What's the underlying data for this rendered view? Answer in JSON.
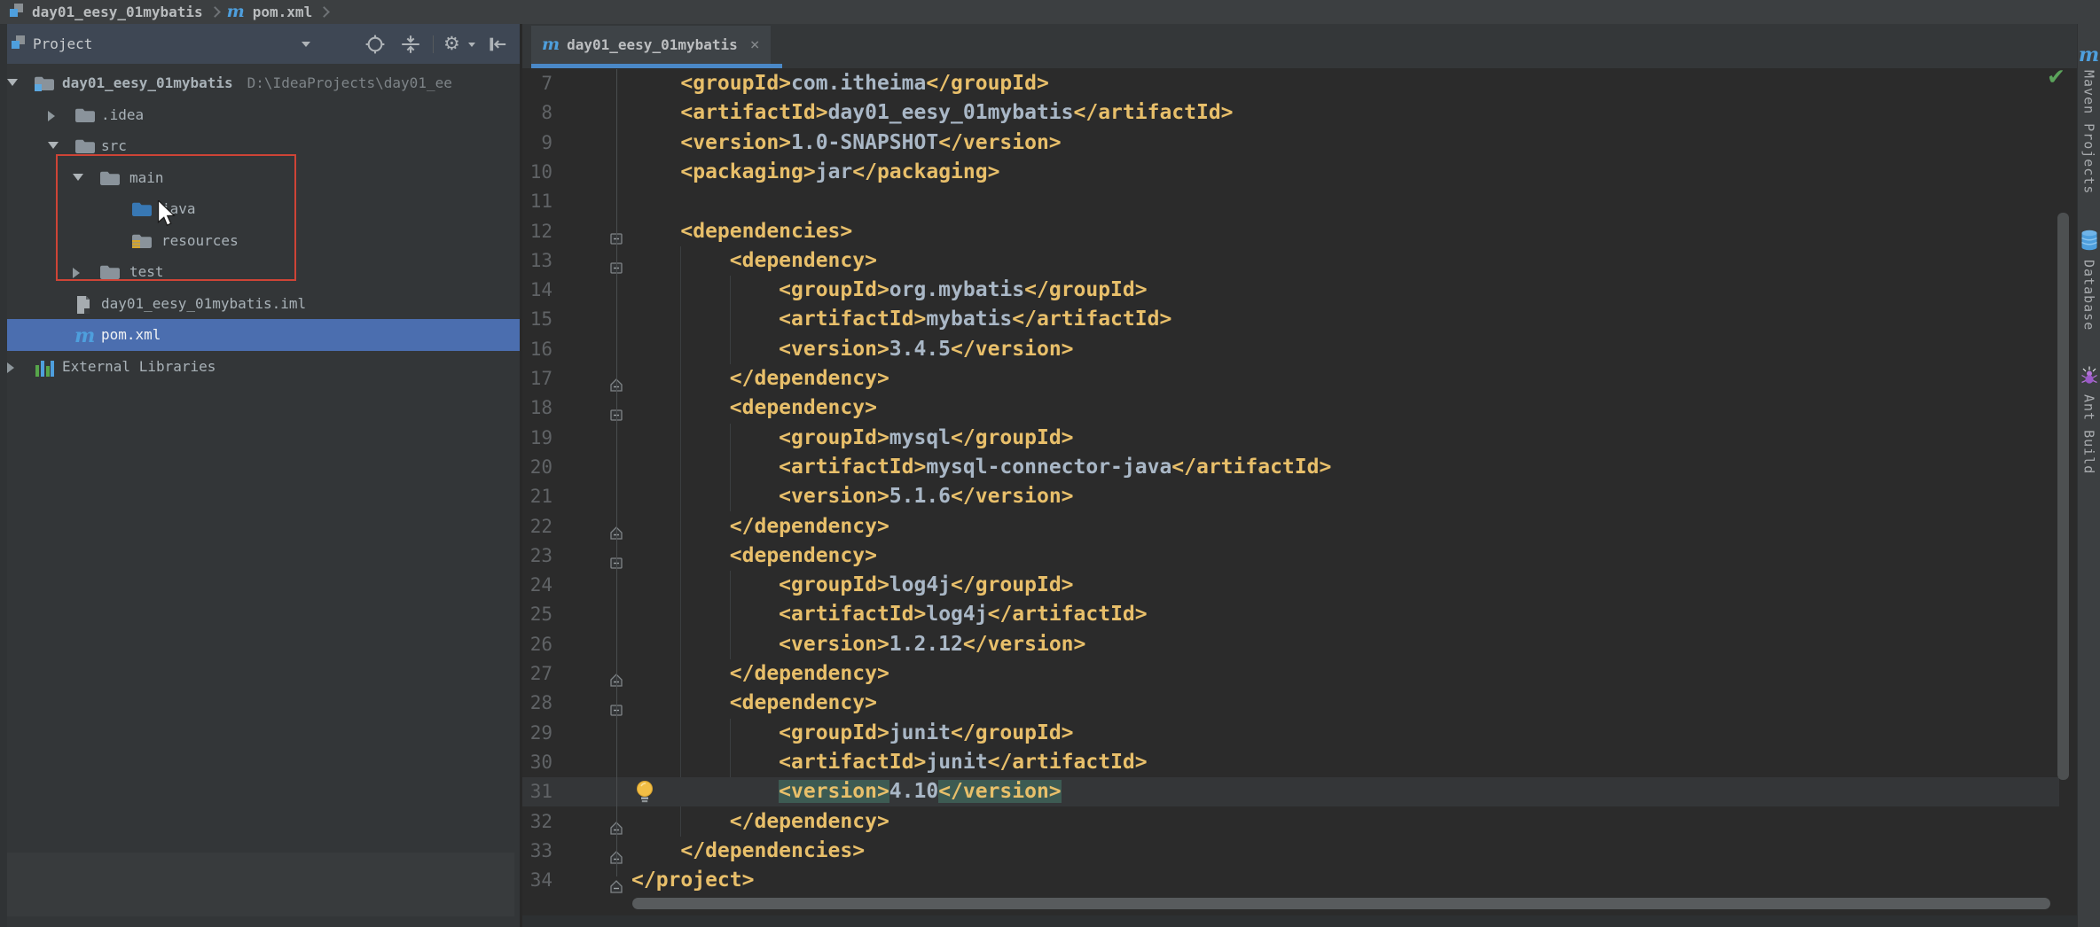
{
  "window": {
    "breadcrumb": {
      "project_label": "day01_eesy_01mybatis",
      "file_label": "pom.xml"
    }
  },
  "project_panel": {
    "title": "Project",
    "toolbar": [
      {
        "icon": "locate"
      },
      {
        "icon": "collapse-all"
      },
      {
        "icon": "settings-gear"
      },
      {
        "icon": "hide-panel"
      }
    ],
    "tree": [
      {
        "label": "day01_eesy_01mybatis",
        "path": "D:\\IdeaProjects\\day01_ee",
        "icon": "project-folder",
        "arrow": "down",
        "level": 0,
        "bold": true
      },
      {
        "label": ".idea",
        "icon": "folder",
        "arrow": "right",
        "level": 1
      },
      {
        "label": "src",
        "icon": "folder",
        "arrow": "down",
        "level": 1
      },
      {
        "label": "main",
        "icon": "folder",
        "arrow": "down",
        "level": 2
      },
      {
        "label": "java",
        "icon": "folder-java",
        "arrow": "none",
        "level": 3,
        "cursor": true
      },
      {
        "label": "resources",
        "icon": "folder-resources",
        "arrow": "none",
        "level": 3
      },
      {
        "label": "test",
        "icon": "folder",
        "arrow": "right",
        "level": 2
      },
      {
        "label": "day01_eesy_01mybatis.iml",
        "icon": "iml-file",
        "arrow": "none",
        "level": 1
      },
      {
        "label": "pom.xml",
        "icon": "maven",
        "arrow": "none",
        "level": 1,
        "selected": true
      },
      {
        "label": "External Libraries",
        "icon": "library",
        "arrow": "right",
        "level": 0
      }
    ]
  },
  "editor": {
    "tab": {
      "icon": "maven",
      "label": "day01_eesy_01mybatis",
      "close": "×",
      "active": true
    },
    "inspection_status": "✔",
    "lines": [
      {
        "n": 7,
        "ind": 4,
        "seg": [
          [
            "t",
            "<groupId>"
          ],
          [
            "x",
            "com.itheima"
          ],
          [
            "t",
            "</groupId>"
          ]
        ]
      },
      {
        "n": 8,
        "ind": 4,
        "seg": [
          [
            "t",
            "<artifactId>"
          ],
          [
            "x",
            "day01_eesy_01mybatis"
          ],
          [
            "t",
            "</artifactId>"
          ]
        ]
      },
      {
        "n": 9,
        "ind": 4,
        "seg": [
          [
            "t",
            "<version>"
          ],
          [
            "x",
            "1.0-SNAPSHOT"
          ],
          [
            "t",
            "</version>"
          ]
        ]
      },
      {
        "n": 10,
        "ind": 4,
        "seg": [
          [
            "t",
            "<packaging>"
          ],
          [
            "x",
            "jar"
          ],
          [
            "t",
            "</packaging>"
          ]
        ]
      },
      {
        "n": 11,
        "ind": 0,
        "seg": []
      },
      {
        "n": 12,
        "ind": 4,
        "fold": "minus",
        "seg": [
          [
            "t",
            "<dependencies>"
          ]
        ]
      },
      {
        "n": 13,
        "ind": 8,
        "fold": "minus",
        "seg": [
          [
            "t",
            "<dependency>"
          ]
        ]
      },
      {
        "n": 14,
        "ind": 12,
        "seg": [
          [
            "t",
            "<groupId>"
          ],
          [
            "x",
            "org.mybatis"
          ],
          [
            "t",
            "</groupId>"
          ]
        ]
      },
      {
        "n": 15,
        "ind": 12,
        "seg": [
          [
            "t",
            "<artifactId>"
          ],
          [
            "x",
            "mybatis"
          ],
          [
            "t",
            "</artifactId>"
          ]
        ]
      },
      {
        "n": 16,
        "ind": 12,
        "seg": [
          [
            "t",
            "<version>"
          ],
          [
            "x",
            "3.4.5"
          ],
          [
            "t",
            "</version>"
          ]
        ]
      },
      {
        "n": 17,
        "ind": 8,
        "fold": "end",
        "seg": [
          [
            "t",
            "</dependency>"
          ]
        ]
      },
      {
        "n": 18,
        "ind": 8,
        "fold": "minus",
        "seg": [
          [
            "t",
            "<dependency>"
          ]
        ]
      },
      {
        "n": 19,
        "ind": 12,
        "seg": [
          [
            "t",
            "<groupId>"
          ],
          [
            "x",
            "mysql"
          ],
          [
            "t",
            "</groupId>"
          ]
        ]
      },
      {
        "n": 20,
        "ind": 12,
        "seg": [
          [
            "t",
            "<artifactId>"
          ],
          [
            "x",
            "mysql-connector-java"
          ],
          [
            "t",
            "</artifactId>"
          ]
        ]
      },
      {
        "n": 21,
        "ind": 12,
        "seg": [
          [
            "t",
            "<version>"
          ],
          [
            "x",
            "5.1.6"
          ],
          [
            "t",
            "</version>"
          ]
        ]
      },
      {
        "n": 22,
        "ind": 8,
        "fold": "end",
        "seg": [
          [
            "t",
            "</dependency>"
          ]
        ]
      },
      {
        "n": 23,
        "ind": 8,
        "fold": "minus",
        "seg": [
          [
            "t",
            "<dependency>"
          ]
        ]
      },
      {
        "n": 24,
        "ind": 12,
        "seg": [
          [
            "t",
            "<groupId>"
          ],
          [
            "x",
            "log4j"
          ],
          [
            "t",
            "</groupId>"
          ]
        ]
      },
      {
        "n": 25,
        "ind": 12,
        "seg": [
          [
            "t",
            "<artifactId>"
          ],
          [
            "x",
            "log4j"
          ],
          [
            "t",
            "</artifactId>"
          ]
        ]
      },
      {
        "n": 26,
        "ind": 12,
        "seg": [
          [
            "t",
            "<version>"
          ],
          [
            "x",
            "1.2.12"
          ],
          [
            "t",
            "</version>"
          ]
        ]
      },
      {
        "n": 27,
        "ind": 8,
        "fold": "end",
        "seg": [
          [
            "t",
            "</dependency>"
          ]
        ]
      },
      {
        "n": 28,
        "ind": 8,
        "fold": "minus",
        "seg": [
          [
            "t",
            "<dependency>"
          ]
        ]
      },
      {
        "n": 29,
        "ind": 12,
        "seg": [
          [
            "t",
            "<groupId>"
          ],
          [
            "x",
            "junit"
          ],
          [
            "t",
            "</groupId>"
          ]
        ]
      },
      {
        "n": 30,
        "ind": 12,
        "seg": [
          [
            "t",
            "<artifactId>"
          ],
          [
            "x",
            "junit"
          ],
          [
            "t",
            "</artifactId>"
          ]
        ]
      },
      {
        "n": 31,
        "ind": 12,
        "bulb": true,
        "current": true,
        "seg": [
          [
            "h",
            "<version>"
          ],
          [
            "x",
            "4.10"
          ],
          [
            "h",
            "</version>"
          ]
        ]
      },
      {
        "n": 32,
        "ind": 8,
        "fold": "end",
        "seg": [
          [
            "t",
            "</dependency>"
          ]
        ]
      },
      {
        "n": 33,
        "ind": 4,
        "fold": "end",
        "seg": [
          [
            "t",
            "</dependencies>"
          ]
        ]
      },
      {
        "n": 34,
        "ind": 0,
        "fold": "end",
        "seg": [
          [
            "t",
            "</project>"
          ]
        ]
      }
    ]
  },
  "right_stripe": {
    "items": [
      {
        "icon": "maven",
        "label": "Maven Projects"
      },
      {
        "icon": "database",
        "label": "Database"
      },
      {
        "icon": "ant",
        "label": "Ant Build"
      }
    ]
  },
  "colors": {
    "accent_underline": "#4A88C7",
    "selection_blue": "#4B6EAF",
    "xml_tag": "#E8BF6A",
    "xml_text": "#A9B7C6",
    "tag_match_bg": "#3D5B53",
    "annotation_red": "#CE4436",
    "maven_blue": "#4E9FDD",
    "check_green": "#5BA35B",
    "bulb_yellow": "#F2BE45"
  }
}
